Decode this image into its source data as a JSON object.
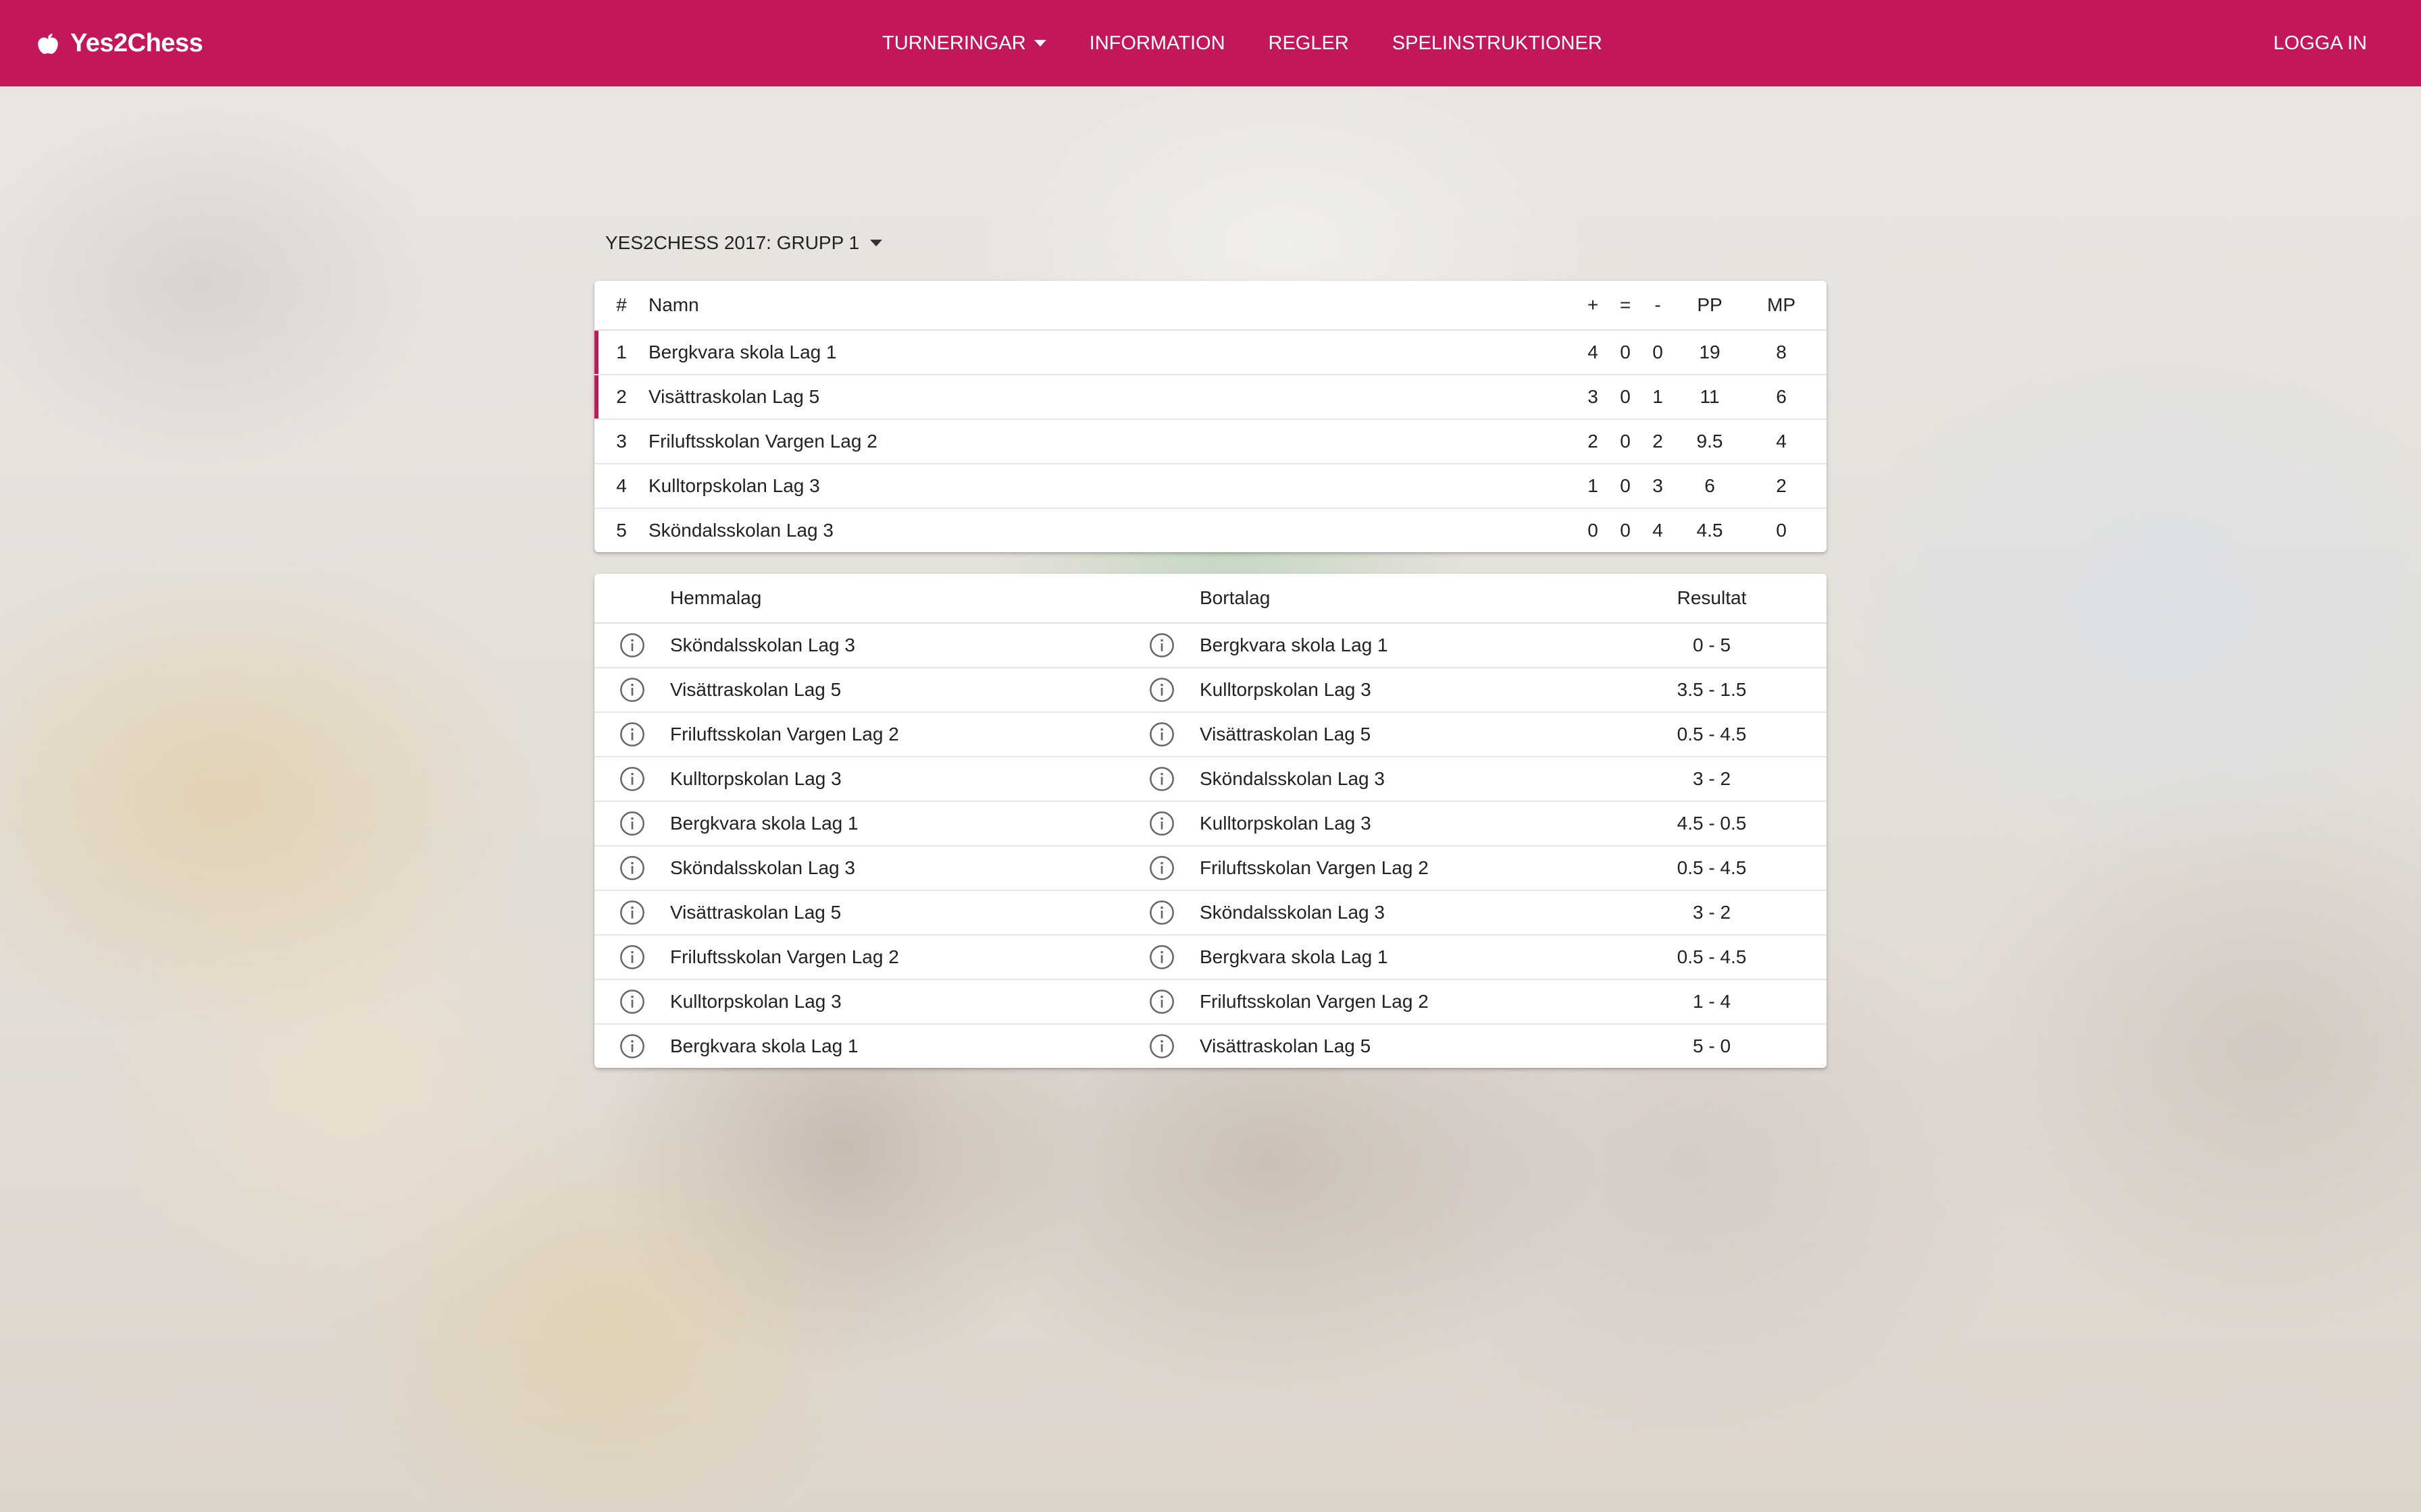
{
  "navbar": {
    "brand": "Yes2Chess",
    "brand_icon": "apple-logo-icon",
    "items": [
      {
        "label": "TURNERINGAR",
        "has_dropdown": true
      },
      {
        "label": "INFORMATION"
      },
      {
        "label": "REGLER"
      },
      {
        "label": "SPELINSTRUKTIONER"
      }
    ],
    "login": "LOGGA IN"
  },
  "group_selector": {
    "label": "YES2CHESS 2017: GRUPP 1",
    "icon": "caret-down-icon"
  },
  "standings": {
    "headers": {
      "rank": "#",
      "name": "Namn",
      "wins": "+",
      "draws": "=",
      "losses": "-",
      "pp": "PP",
      "mp": "MP"
    },
    "rows": [
      {
        "rank": "1",
        "name": "Bergkvara skola Lag 1",
        "wins": "4",
        "draws": "0",
        "losses": "0",
        "pp": "19",
        "mp": "8",
        "highlight": true
      },
      {
        "rank": "2",
        "name": "Visättraskolan Lag 5",
        "wins": "3",
        "draws": "0",
        "losses": "1",
        "pp": "11",
        "mp": "6",
        "highlight": true
      },
      {
        "rank": "3",
        "name": "Friluftsskolan Vargen Lag 2",
        "wins": "2",
        "draws": "0",
        "losses": "2",
        "pp": "9.5",
        "mp": "4",
        "highlight": false
      },
      {
        "rank": "4",
        "name": "Kulltorpskolan Lag 3",
        "wins": "1",
        "draws": "0",
        "losses": "3",
        "pp": "6",
        "mp": "2",
        "highlight": false
      },
      {
        "rank": "5",
        "name": "Sköndalsskolan Lag 3",
        "wins": "0",
        "draws": "0",
        "losses": "4",
        "pp": "4.5",
        "mp": "0",
        "highlight": false
      }
    ]
  },
  "matches": {
    "headers": {
      "home": "Hemmalag",
      "away": "Bortalag",
      "result": "Resultat"
    },
    "rows": [
      {
        "home": "Sköndalsskolan Lag 3",
        "away": "Bergkvara skola Lag 1",
        "result": "0 - 5"
      },
      {
        "home": "Visättraskolan Lag 5",
        "away": "Kulltorpskolan Lag 3",
        "result": "3.5 - 1.5"
      },
      {
        "home": "Friluftsskolan Vargen Lag 2",
        "away": "Visättraskolan Lag 5",
        "result": "0.5 - 4.5"
      },
      {
        "home": "Kulltorpskolan Lag 3",
        "away": "Sköndalsskolan Lag 3",
        "result": "3 - 2"
      },
      {
        "home": "Bergkvara skola Lag 1",
        "away": "Kulltorpskolan Lag 3",
        "result": "4.5 - 0.5"
      },
      {
        "home": "Sköndalsskolan Lag 3",
        "away": "Friluftsskolan Vargen Lag 2",
        "result": "0.5 - 4.5"
      },
      {
        "home": "Visättraskolan Lag 5",
        "away": "Sköndalsskolan Lag 3",
        "result": "3 - 2"
      },
      {
        "home": "Friluftsskolan Vargen Lag 2",
        "away": "Bergkvara skola Lag 1",
        "result": "0.5 - 4.5"
      },
      {
        "home": "Kulltorpskolan Lag 3",
        "away": "Friluftsskolan Vargen Lag 2",
        "result": "1 - 4"
      },
      {
        "home": "Bergkvara skola Lag 1",
        "away": "Visättraskolan Lag 5",
        "result": "5 - 0"
      }
    ],
    "row_icon": "info-circle-icon"
  },
  "colors": {
    "brand": "#c2185b",
    "highlight_bar": "#c2185b"
  }
}
